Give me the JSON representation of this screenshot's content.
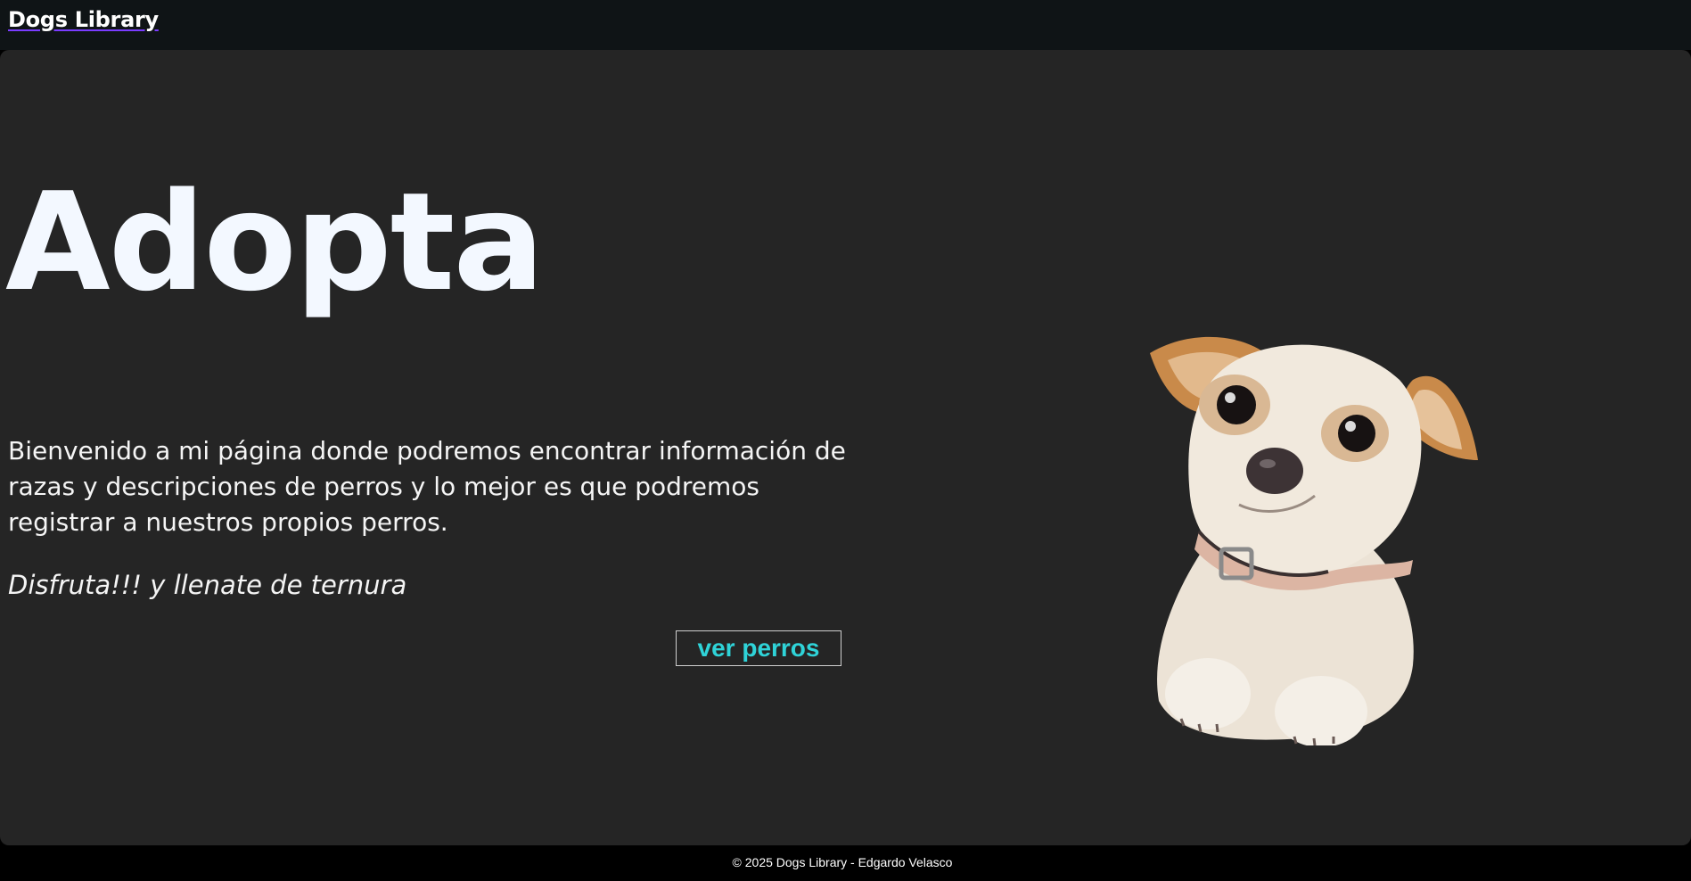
{
  "navbar": {
    "brand": "Dogs Library"
  },
  "hero": {
    "title": "Adopta",
    "intro": "Bienvenido a mi página donde podremos encontrar información de razas y descripciones de perros y lo mejor es que podremos registrar a nuestros propios perros.",
    "tagline": "Disfruta!!! y llenate de ternura",
    "cta_label": "ver perros",
    "image": "dog-photo"
  },
  "footer": {
    "text": "© 2025 Dogs Library - Edgardo Velasco"
  },
  "colors": {
    "navbar_bg": "#0f1416",
    "main_bg": "#252525",
    "title": "#f3f8ff",
    "accent": "#2fd3d8",
    "footer_bg": "#000000"
  }
}
